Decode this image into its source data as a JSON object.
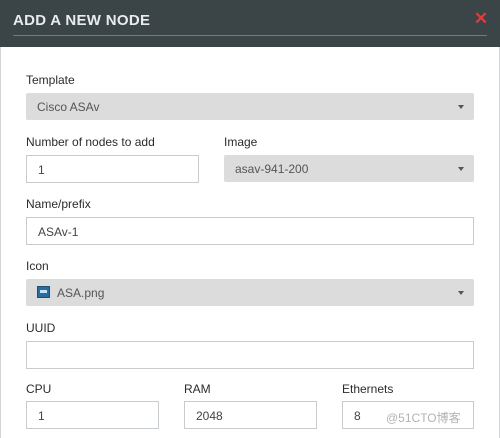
{
  "dialog": {
    "title": "ADD A NEW NODE",
    "close_icon": "close-icon"
  },
  "fields": {
    "template": {
      "label": "Template",
      "value": "Cisco ASAv"
    },
    "num_nodes": {
      "label": "Number of nodes to add",
      "value": "1"
    },
    "image": {
      "label": "Image",
      "value": "asav-941-200"
    },
    "name_prefix": {
      "label": "Name/prefix",
      "value": "ASAv-1"
    },
    "icon": {
      "label": "Icon",
      "value": "ASA.png",
      "icon_name": "asa-device-icon"
    },
    "uuid": {
      "label": "UUID",
      "value": ""
    },
    "cpu": {
      "label": "CPU",
      "value": "1"
    },
    "ram": {
      "label": "RAM",
      "value": "2048"
    },
    "ethernets": {
      "label": "Ethernets",
      "value": "8"
    }
  },
  "watermark": "@51CTO博客",
  "colors": {
    "header_bg": "#3b4446",
    "close": "#e23b3b",
    "select_bg": "#dcdcdc"
  }
}
